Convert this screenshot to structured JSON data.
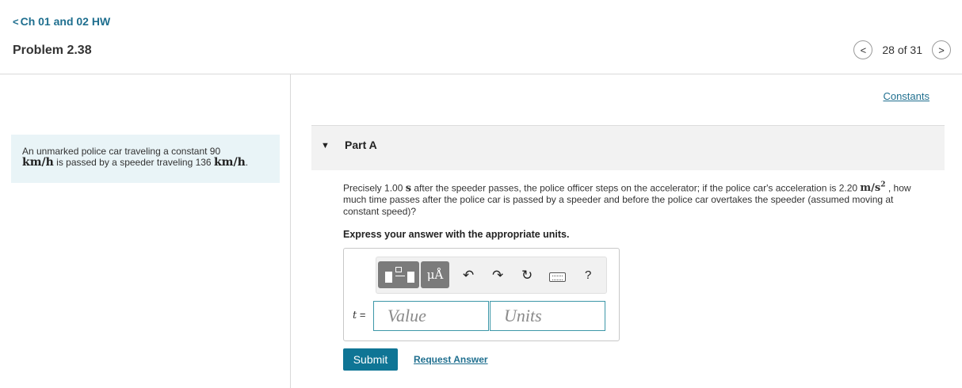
{
  "nav": {
    "back_chevron": "<",
    "back_label": "Ch 01 and 02 HW",
    "problem_title": "Problem 2.38",
    "prev_icon": "<",
    "next_icon": ">",
    "page_count": "28 of 31"
  },
  "intro": {
    "text_before": "An unmarked police car traveling a constant 90",
    "unit1": "km/h",
    "text_middle": " is passed by a speeder traveling 136 ",
    "unit2": "km/h",
    "text_end": "."
  },
  "constants_link": "Constants",
  "part": {
    "toggle_icon": "▼",
    "label": "Part A"
  },
  "question": {
    "text1": "Precisely 1.00 ",
    "unit_s": "s",
    "text2": " after the speeder passes, the police officer steps on the accelerator; if the police car's acceleration is 2.20 ",
    "accel_unit": "m/s",
    "accel_exp": "2",
    "text3": " , how much time passes after the police car is passed by a speeder and before the police car overtakes the speeder (assumed moving at constant speed)?"
  },
  "instruction": "Express your answer with the appropriate units.",
  "toolbar": {
    "mu_label": "μÅ",
    "undo_icon": "↶",
    "redo_icon": "↷",
    "reset_icon": "↻",
    "help_label": "?"
  },
  "answer": {
    "var": "t",
    "equals": " =",
    "value_placeholder": "Value",
    "units_placeholder": "Units"
  },
  "actions": {
    "submit_label": "Submit",
    "request_label": "Request Answer"
  },
  "icons": [
    "chevron-left-icon",
    "chevron-right-icon",
    "triangle-down-icon",
    "template-icon",
    "undo-icon",
    "redo-icon",
    "reset-icon",
    "keyboard-icon"
  ],
  "colors": {
    "accent": "#0f7595",
    "link": "#1f6f8f",
    "intro_bg": "#e9f4f7",
    "part_bg": "#f2f2f2",
    "field_border": "#3c97a8"
  }
}
